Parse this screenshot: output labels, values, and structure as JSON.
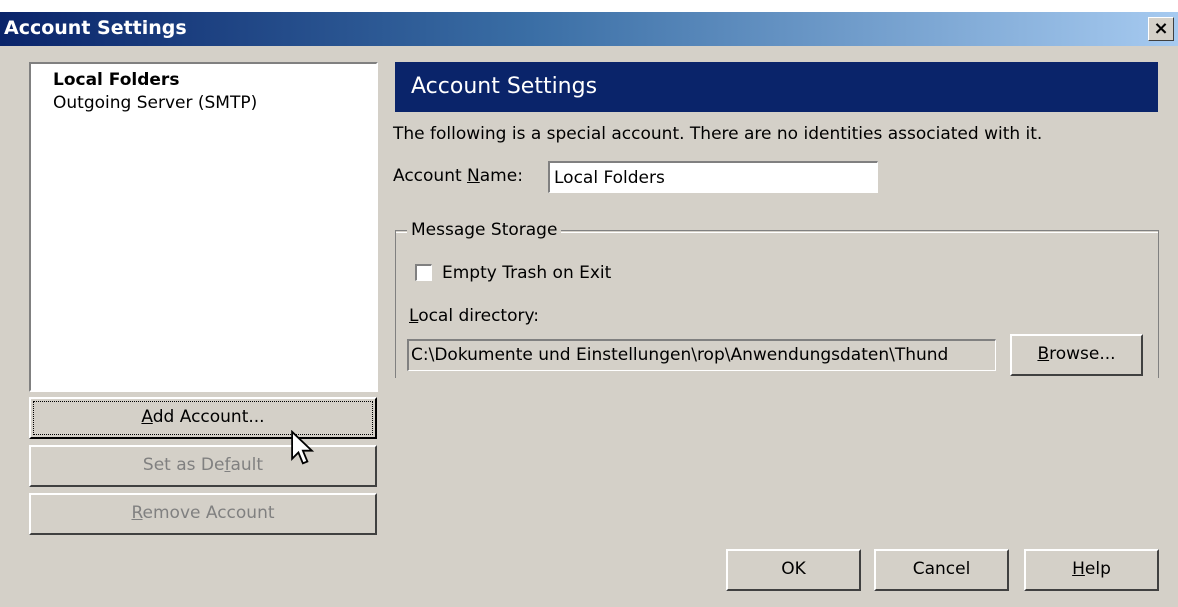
{
  "window": {
    "title": "Account Settings",
    "close_label": "×"
  },
  "sidebar": {
    "items": [
      {
        "label": "Local Folders",
        "selected": true
      },
      {
        "label": "Outgoing Server (SMTP)",
        "selected": false
      }
    ],
    "buttons": {
      "add_account": {
        "prefix": "",
        "accel": "A",
        "rest": "dd Account..."
      },
      "set_default": {
        "prefix": "Set as De",
        "accel": "f",
        "rest": "ault"
      },
      "remove_account": {
        "prefix": "",
        "accel": "R",
        "rest": "emove Account"
      }
    }
  },
  "panel": {
    "header": "Account Settings",
    "description": "The following is a special account. There are no identities associated with it.",
    "account_name_label": {
      "prefix": "Account ",
      "accel": "N",
      "rest": "ame:"
    },
    "account_name_value": "Local Folders",
    "storage": {
      "legend": "Message Storage",
      "empty_trash_label": "Empty Trash on Exit",
      "empty_trash_checked": false,
      "local_dir_label": {
        "prefix": "",
        "accel": "L",
        "rest": "ocal directory:"
      },
      "local_dir_value": "C:\\Dokumente und Einstellungen\\rop\\Anwendungsdaten\\Thund",
      "browse": {
        "prefix": "",
        "accel": "B",
        "rest": "rowse..."
      }
    }
  },
  "footer": {
    "ok": "OK",
    "cancel": "Cancel",
    "help": {
      "prefix": "",
      "accel": "H",
      "rest": "elp"
    }
  },
  "colors": {
    "title_gradient_start": "#0a246a",
    "title_gradient_end": "#a6caf0",
    "dialog_face": "#d4d0c8",
    "header_bg": "#0a246a"
  }
}
